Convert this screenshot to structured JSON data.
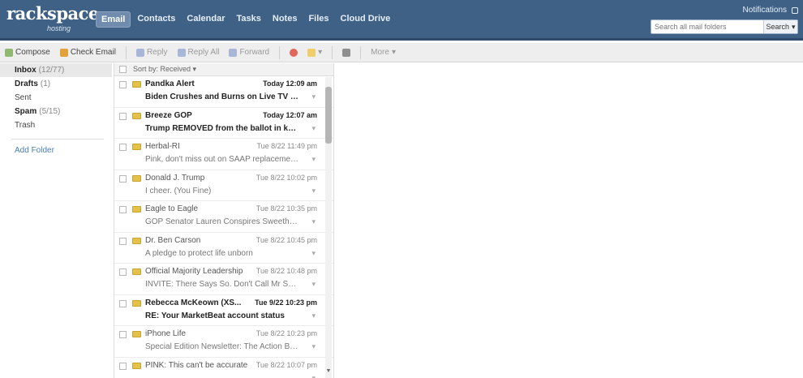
{
  "brand": {
    "logo_main": "rackspace",
    "logo_sub": "hosting"
  },
  "nav": {
    "tabs": [
      {
        "label": "Email",
        "active": true
      },
      {
        "label": "Contacts"
      },
      {
        "label": "Calendar"
      },
      {
        "label": "Tasks"
      },
      {
        "label": "Notes"
      },
      {
        "label": "Files"
      },
      {
        "label": "Cloud Drive"
      }
    ]
  },
  "header": {
    "notifications_label": "Notifications",
    "search_placeholder": "Search all mail folders",
    "search_button": "Search"
  },
  "toolbar": {
    "compose": "Compose",
    "check_email": "Check Email",
    "reply": "Reply",
    "reply_all": "Reply All",
    "forward": "Forward",
    "more": "More"
  },
  "sidebar": {
    "folders": [
      {
        "name": "Inbox",
        "count": "(12/77)",
        "bold": true,
        "selected": true
      },
      {
        "name": "Drafts",
        "count": "(1)",
        "bold": true
      },
      {
        "name": "Sent",
        "count": ""
      },
      {
        "name": "Spam",
        "count": "(5/15)",
        "bold": true
      },
      {
        "name": "Trash",
        "count": ""
      }
    ],
    "add_folder": "Add Folder"
  },
  "list": {
    "sort_label": "Sort by: Received",
    "messages": [
      {
        "from": "Pandka Alert",
        "date": "Today 12:09 am",
        "subject": "Biden Crushes and Burns on Live TV - be...",
        "unread": true
      },
      {
        "from": "Breeze GOP",
        "date": "Today 12:07 am",
        "subject": "Trump REMOVED from the ballot in key s...",
        "unread": true
      },
      {
        "from": "Herbal-RI",
        "date": "Tue 8/22 11:49 pm",
        "subject": "Pink, don't miss out on SAAP replacement edi...",
        "unread": false
      },
      {
        "from": "Donald J. Trump",
        "date": "Tue 8/22 10:02 pm",
        "subject": "I cheer. (You Fine)",
        "unread": false
      },
      {
        "from": "Eagle to Eagle",
        "date": "Tue 8/22 10:35 pm",
        "subject": "GOP Senator Lauren Conspires Sweetheart",
        "unread": false
      },
      {
        "from": "Dr. Ben Carson",
        "date": "Tue 8/22 10:45 pm",
        "subject": "A pledge to protect life unborn",
        "unread": false
      },
      {
        "from": "Official Majority Leadership",
        "date": "Tue 8/22 10:48 pm",
        "subject": "INVITE: There Says So. Don't Call Mr Shadda...",
        "unread": false
      },
      {
        "from": "Rebecca McKeown (XS...",
        "date": "Tue 9/22 10:23 pm",
        "subject": "RE: Your MarketBeat account status",
        "unread": true
      },
      {
        "from": "iPhone Life",
        "date": "Tue 8/22 10:23 pm",
        "subject": "Special Edition Newsletter: The Action Button...",
        "unread": false
      },
      {
        "from": "PINK: This can't be accurate",
        "date": "Tue 8/22 10:07 pm",
        "subject": "",
        "unread": false
      }
    ]
  },
  "colors": {
    "header_bg": "#3f6186",
    "accent_link": "#4a7db5",
    "envelope": "#e4c24a"
  }
}
